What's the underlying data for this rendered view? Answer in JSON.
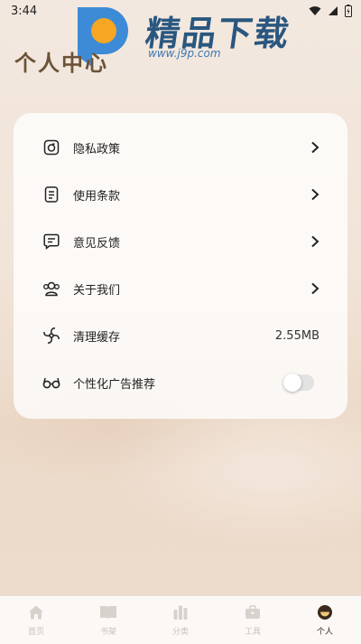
{
  "status_bar": {
    "time": "3:44"
  },
  "watermark": {
    "title": "精品下载",
    "url": "www.j9p.com"
  },
  "header": {
    "title": "个人中心"
  },
  "settings": {
    "items": [
      {
        "icon": "privacy-icon",
        "label": "隐私政策"
      },
      {
        "icon": "document-icon",
        "label": "使用条款"
      },
      {
        "icon": "feedback-icon",
        "label": "意见反馈"
      },
      {
        "icon": "people-icon",
        "label": "关于我们"
      },
      {
        "icon": "fan-icon",
        "label": "清理缓存",
        "value": "2.55MB"
      },
      {
        "icon": "glasses-icon",
        "label": "个性化广告推荐",
        "toggle": false
      }
    ]
  },
  "tabbar": {
    "tabs": [
      {
        "icon": "home-icon",
        "label": "首页"
      },
      {
        "icon": "book-icon",
        "label": "书架"
      },
      {
        "icon": "chart-icon",
        "label": "分类"
      },
      {
        "icon": "toolbox-icon",
        "label": "工具"
      },
      {
        "icon": "profile-icon",
        "label": "个人",
        "active": true
      }
    ]
  },
  "colors": {
    "accent": "#3a2a1c",
    "title": "#6b5338",
    "watermark": "#29577f"
  }
}
